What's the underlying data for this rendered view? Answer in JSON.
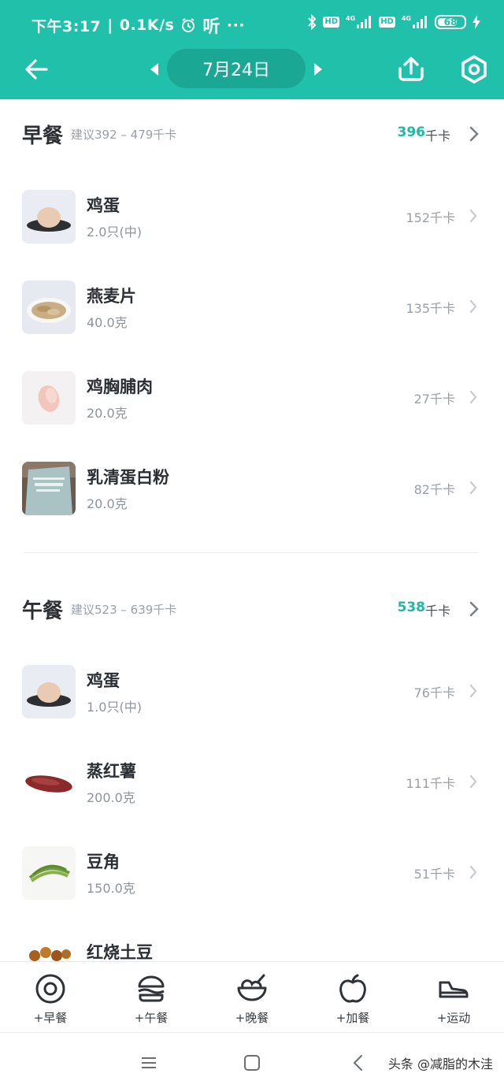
{
  "status_bar": {
    "time": "下午3:17",
    "net_speed": "0.1K/s",
    "listen_text": "听",
    "more": "···",
    "hd_badge": "HD",
    "network_1": "4G",
    "network_2": "4G",
    "battery": "68"
  },
  "nav": {
    "date": "7月24日",
    "back_icon": "back-arrow",
    "share_icon": "share-upload",
    "settings_icon": "settings-hex"
  },
  "meals": [
    {
      "title": "早餐",
      "suggest": "建议392 – 479千卡",
      "kcal": "396",
      "unit": "千卡",
      "items": [
        {
          "name": "鸡蛋",
          "amount": "2.0只(中)",
          "kcal": "152千卡",
          "thumb": "egg"
        },
        {
          "name": "燕麦片",
          "amount": "40.0克",
          "kcal": "135千卡",
          "thumb": "oats"
        },
        {
          "name": "鸡胸脯肉",
          "amount": "20.0克",
          "kcal": "27千卡",
          "thumb": "chicken"
        },
        {
          "name": "乳清蛋白粉",
          "amount": "20.0克",
          "kcal": "82千卡",
          "thumb": "whey"
        }
      ]
    },
    {
      "title": "午餐",
      "suggest": "建议523 – 639千卡",
      "kcal": "538",
      "unit": "千卡",
      "items": [
        {
          "name": "鸡蛋",
          "amount": "1.0只(中)",
          "kcal": "76千卡",
          "thumb": "egg"
        },
        {
          "name": "蒸红薯",
          "amount": "200.0克",
          "kcal": "111千卡",
          "thumb": "sweet-potato"
        },
        {
          "name": "豆角",
          "amount": "150.0克",
          "kcal": "51千卡",
          "thumb": "green-beans"
        },
        {
          "name": "红烧土豆",
          "amount": "",
          "kcal": "",
          "thumb": "braised-potato"
        }
      ]
    }
  ],
  "actions": [
    {
      "label": "+早餐",
      "icon": "egg-icon"
    },
    {
      "label": "+午餐",
      "icon": "burger-icon"
    },
    {
      "label": "+晚餐",
      "icon": "bowl-icon"
    },
    {
      "label": "+加餐",
      "icon": "apple-icon"
    },
    {
      "label": "+运动",
      "icon": "shoe-icon"
    }
  ],
  "watermark": "头条 @减脂的木洼",
  "colors": {
    "accent": "#20c0ab",
    "accent_dark": "#1aa895",
    "kcal_teal": "#20b8a5"
  }
}
